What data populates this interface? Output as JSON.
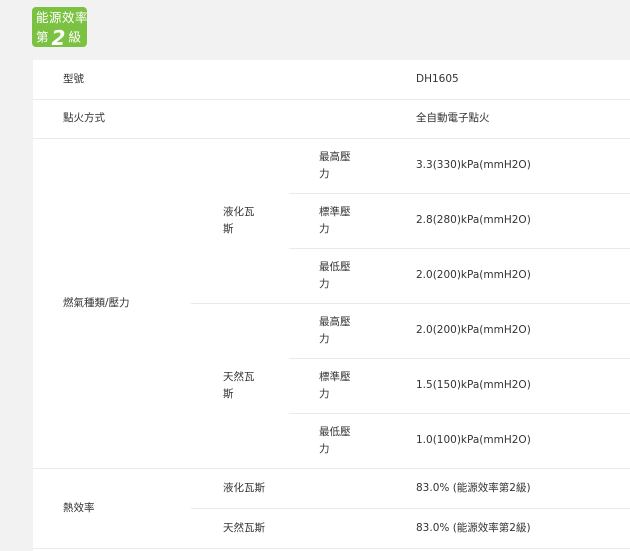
{
  "badge": {
    "line1": "能源效率",
    "prefix": "第",
    "grade": "2",
    "suffix": "級"
  },
  "specs": {
    "model_label": "型號",
    "model_value": "DH1605",
    "ignition_label": "點火方式",
    "ignition_value": "全自動電子點火",
    "gas_label": "燃氣種類/壓力",
    "lpg_label": "液化瓦斯",
    "ng_label": "天然瓦斯",
    "max_label": "最高壓力",
    "std_label": "標準壓力",
    "min_label": "最低壓力",
    "lpg": {
      "max": "3.3(330)kPa(mmH2O)",
      "std": "2.8(280)kPa(mmH2O)",
      "min": "2.0(200)kPa(mmH2O)"
    },
    "ng": {
      "max": "2.0(200)kPa(mmH2O)",
      "std": "1.5(150)kPa(mmH2O)",
      "min": "1.0(100)kPa(mmH2O)"
    },
    "efficiency_label": "熱效率",
    "lpg_efficiency": "83.0% (能源效率第2級)",
    "ng_efficiency": "83.0% (能源效率第2級)"
  }
}
